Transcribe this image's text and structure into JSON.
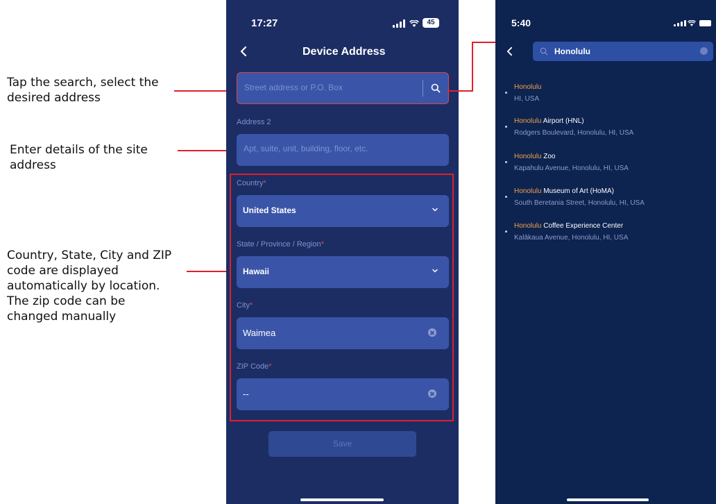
{
  "annotations": [
    {
      "text": "Tap the search, select the desired address"
    },
    {
      "text": "Enter details of the site address"
    },
    {
      "text": "Country, State, City and ZIP code are displayed automatically by location. The zip code can be changed manually"
    }
  ],
  "left_phone": {
    "status": {
      "time": "17:27",
      "battery": "45"
    },
    "header": {
      "title": "Device Address"
    },
    "address1": {
      "placeholder": "Street address or P.O. Box"
    },
    "address2": {
      "label": "Address 2",
      "placeholder": "Apt, suite, unit, building, floor, etc."
    },
    "country": {
      "label": "Country",
      "required_mark": "*",
      "value": "United States"
    },
    "state": {
      "label": "State / Province / Region",
      "required_mark": "*",
      "value": "Hawaii"
    },
    "city": {
      "label": "City",
      "required_mark": "*",
      "value": "Waimea"
    },
    "zip": {
      "label": "ZIP Code",
      "required_mark": "*",
      "value": "--"
    },
    "save_label": "Save"
  },
  "right_phone": {
    "status": {
      "time": "5:40"
    },
    "search": {
      "query": "Honolulu"
    },
    "results": [
      {
        "highlight": "Honolulu",
        "rest": "",
        "sub": "HI, USA"
      },
      {
        "highlight": "Honolulu",
        "rest": " Airport (HNL)",
        "sub": "Rodgers Boulevard, Honolulu, HI, USA"
      },
      {
        "highlight": "Honolulu",
        "rest": " Zoo",
        "sub": "Kapahulu Avenue, Honolulu, HI, USA"
      },
      {
        "highlight": "Honolulu",
        "rest": " Museum of Art (HoMA)",
        "sub": "South Beretania Street, Honolulu, HI, USA"
      },
      {
        "highlight": "Honolulu",
        "rest": " Coffee Experience Center",
        "sub": "Kalākaua Avenue, Honolulu, HI, USA"
      }
    ]
  },
  "colors": {
    "accent_red": "#e0202a",
    "left_background": "#1c2d64",
    "right_background": "#0d2350",
    "field_background": "#3a55a8",
    "highlight": "#f0a24b"
  },
  "icons": [
    "back-chevron-icon",
    "search-icon",
    "chevron-down-icon",
    "clear-icon",
    "signal-icon",
    "wifi-icon",
    "battery-icon"
  ]
}
